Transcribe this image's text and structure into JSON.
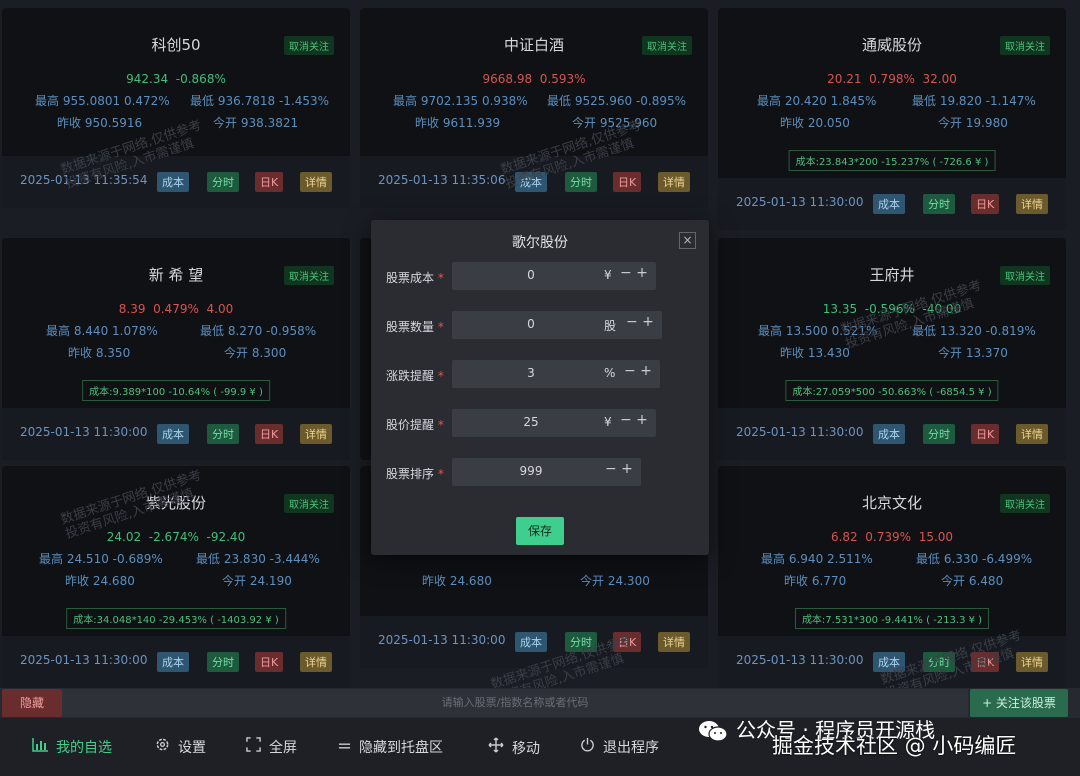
{
  "cards": [
    {
      "name": "科创50",
      "unfollow": "取消关注",
      "price": "942.34",
      "change": "-0.868%",
      "delta": "",
      "high_label": "最高",
      "high": "955.0801",
      "high_pct": "0.472%",
      "low_label": "最低",
      "low": "936.7818",
      "low_pct": "-1.453%",
      "close_label": "昨收",
      "prev_close": "950.5916",
      "open_label": "今开",
      "open": "938.3821",
      "cost": "",
      "time": "2025-01-13 11:35:54"
    },
    {
      "name": "中证白酒",
      "unfollow": "取消关注",
      "price": "9668.98",
      "change": "0.593%",
      "delta": "",
      "high_label": "最高",
      "high": "9702.135",
      "high_pct": "0.938%",
      "low_label": "最低",
      "low": "9525.960",
      "low_pct": "-0.895%",
      "close_label": "昨收",
      "prev_close": "9611.939",
      "open_label": "今开",
      "open": "9525.960",
      "cost": "",
      "time": "2025-01-13 11:35:06"
    },
    {
      "name": "通威股份",
      "unfollow": "取消关注",
      "price": "20.21",
      "change": "0.798%",
      "delta": "32.00",
      "high_label": "最高",
      "high": "20.420",
      "high_pct": "1.845%",
      "low_label": "最低",
      "low": "19.820",
      "low_pct": "-1.147%",
      "close_label": "昨收",
      "prev_close": "20.050",
      "open_label": "今开",
      "open": "19.980",
      "cost": "成本:23.843*200 -15.237% ( -726.6 ¥ )",
      "time": "2025-01-13 11:30:00"
    },
    {
      "name": "新 希 望",
      "unfollow": "取消关注",
      "price": "8.39",
      "change": "0.479%",
      "delta": "4.00",
      "high_label": "最高",
      "high": "8.440",
      "high_pct": "1.078%",
      "low_label": "最低",
      "low": "8.270",
      "low_pct": "-0.958%",
      "close_label": "昨收",
      "prev_close": "8.350",
      "open_label": "今开",
      "open": "8.300",
      "cost": "成本:9.389*100 -10.64% ( -99.9 ¥ )",
      "time": "2025-01-13 11:30:00"
    },
    {
      "name": "王府井",
      "unfollow": "取消关注",
      "price": "13.35",
      "change": "-0.596%",
      "delta": "-40.00",
      "high_label": "最高",
      "high": "13.500",
      "high_pct": "0.521%",
      "low_label": "最低",
      "low": "13.320",
      "low_pct": "-0.819%",
      "close_label": "昨收",
      "prev_close": "13.430",
      "open_label": "今开",
      "open": "13.370",
      "cost": "成本:27.059*500 -50.663% ( -6854.5 ¥ )",
      "time": "2025-01-13 11:30:00"
    },
    {
      "name": "紫光股份",
      "unfollow": "取消关注",
      "price": "24.02",
      "change": "-2.674%",
      "delta": "-92.40",
      "high_label": "最高",
      "high": "24.510",
      "high_pct": "-0.689%",
      "low_label": "最低",
      "low": "23.830",
      "low_pct": "-3.444%",
      "close_label": "昨收",
      "prev_close": "24.680",
      "open_label": "今开",
      "open": "24.190",
      "cost": "成本:34.048*140 -29.453% ( -1403.92 ¥ )",
      "time": "2025-01-13 11:30:00"
    },
    {
      "name": "北京文化",
      "unfollow": "取消关注",
      "price": "6.82",
      "change": "0.739%",
      "delta": "15.00",
      "high_label": "最高",
      "high": "6.940",
      "high_pct": "2.511%",
      "low_label": "最低",
      "low": "6.330",
      "low_pct": "-6.499%",
      "close_label": "昨收",
      "prev_close": "6.770",
      "open_label": "今开",
      "open": "6.480",
      "cost": "成本:7.531*300 -9.441% ( -213.3 ¥ )",
      "time": "2025-01-13 11:30:00"
    }
  ],
  "hidden_card": {
    "close_label": "昨收",
    "prev_close": "24.680",
    "open_label": "今开",
    "open": "24.300",
    "time": "2025-01-13 11:30:00"
  },
  "card_buttons": {
    "cost": "成本",
    "intraday": "分时",
    "daily_k": "日K",
    "detail": "详情"
  },
  "watermark": {
    "line1": "数据来源于网络,仅供参考",
    "line2": "投资有风险,入市需谨慎"
  },
  "modal": {
    "title": "歌尔股份",
    "close": "×",
    "fields": [
      {
        "label": "股票成本",
        "value": "0",
        "unit": "¥"
      },
      {
        "label": "股票数量",
        "value": "0",
        "unit": "股"
      },
      {
        "label": "涨跌提醒",
        "value": "3",
        "unit": "%"
      },
      {
        "label": "股价提醒",
        "value": "25",
        "unit": "¥"
      },
      {
        "label": "股票排序",
        "value": "999",
        "unit": ""
      }
    ],
    "required_mark": "*",
    "save": "保存"
  },
  "searchbar": {
    "hide": "隐藏",
    "placeholder": "请输入股票/指数名称或者代码",
    "follow": "+ 关注该股票"
  },
  "nav": [
    {
      "label": "我的自选",
      "icon": "bar-chart-icon"
    },
    {
      "label": "设置",
      "icon": "gear-icon"
    },
    {
      "label": "全屏",
      "icon": "fullscreen-icon"
    },
    {
      "label": "隐藏到托盘区",
      "icon": "tray-icon"
    },
    {
      "label": "移动",
      "icon": "move-icon"
    },
    {
      "label": "退出程序",
      "icon": "power-icon"
    }
  ],
  "overlay": {
    "text": "公众号 · 程序员开源栈"
  },
  "credit": {
    "text": "掘金技术社区 @ 小码编匠"
  },
  "colors": {
    "up": "#d9534f",
    "down": "#3fbf7a",
    "accent": "#3ecf8e",
    "label": "#5b8fbf"
  }
}
